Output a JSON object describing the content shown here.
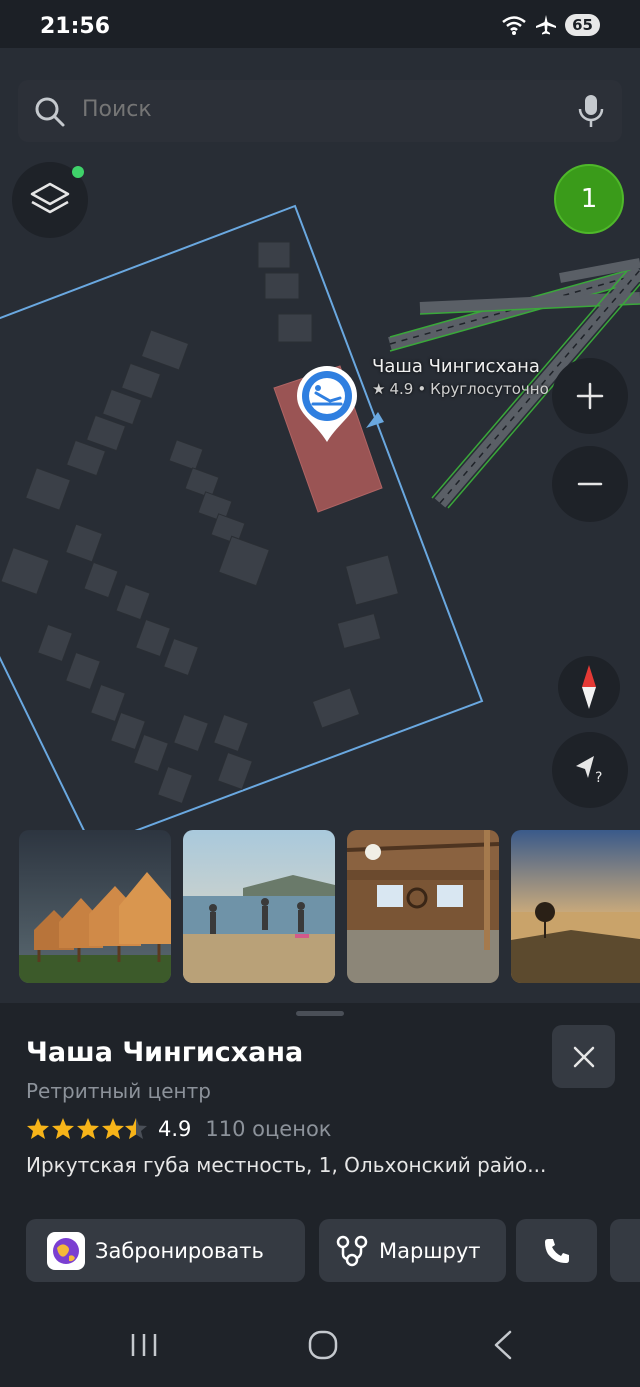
{
  "status_bar": {
    "time": "21:56",
    "battery": "65"
  },
  "search": {
    "placeholder": "Поиск"
  },
  "map": {
    "cluster_count": "1",
    "poi": {
      "name": "Чаша Чингисхана",
      "rating": "4.9",
      "hours": "Круглосуточно"
    }
  },
  "photos": [
    {
      "subject": "wooden cabins"
    },
    {
      "subject": "yoga by the lake"
    },
    {
      "subject": "wooden hall interior"
    },
    {
      "subject": "lake sunset"
    }
  ],
  "place": {
    "title": "Чаша Чингисхана",
    "category": "Ретритный центр",
    "rating": "4.9",
    "rating_value": 4.5,
    "reviews": "110 оценок",
    "address": "Иркутская губа местность, 1, Ольхонский райо..."
  },
  "actions": {
    "book": "Забронировать",
    "route": "Маршрут"
  },
  "colors": {
    "accent_green": "#3a9b1a",
    "poi_blue": "#2f7fe0",
    "building_red": "#9a5454",
    "star": "#f7b419"
  }
}
